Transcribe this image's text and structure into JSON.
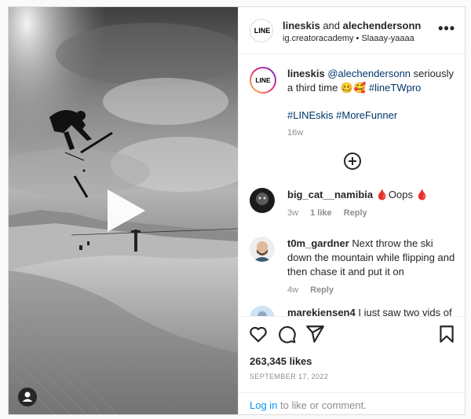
{
  "colors": {
    "accent": "#0095f6",
    "link": "#00376b",
    "muted": "#8e8e8e",
    "text": "#262626"
  },
  "header": {
    "account_logo_text": "LINE",
    "title_user1": "lineskis",
    "title_and": " and ",
    "title_user2": "alechendersonn",
    "subtitle": "ig.creatoracademy • Slaaay-yaaaa",
    "more_icon": "more-horizontal-icon"
  },
  "media": {
    "play_icon": "play-icon",
    "tagged_user_icon": "user-icon"
  },
  "caption": {
    "avatar_text": "LINE",
    "username": "lineskis",
    "mention": "@alechendersonn",
    "text": " seriously a third time 🥴🥰 ",
    "hashtag1": "#lineTWpro",
    "hashtags": "#LINEskis #MoreFunner",
    "age": "16w"
  },
  "load_more_icon": "plus-circle-icon",
  "comments": [
    {
      "username": "big_cat__namibia",
      "text": " 🩸Oops 🩸",
      "age": "3w",
      "likes": "1 like",
      "reply": "Reply"
    },
    {
      "username": "t0m_gardner",
      "text": " Next throw the ski down the mountain while flipping and then chase it and put it on",
      "age": "4w",
      "reply": "Reply"
    },
    {
      "username": "marekjensen4",
      "text": " I just saw two vids of"
    }
  ],
  "actions": {
    "like_icon": "heart-icon",
    "comment_icon": "comment-icon",
    "share_icon": "send-icon",
    "save_icon": "bookmark-icon"
  },
  "likes": "263,345 likes",
  "date": "SEPTEMBER 17, 2022",
  "footer": {
    "login": "Log in",
    "rest": " to like or comment."
  }
}
